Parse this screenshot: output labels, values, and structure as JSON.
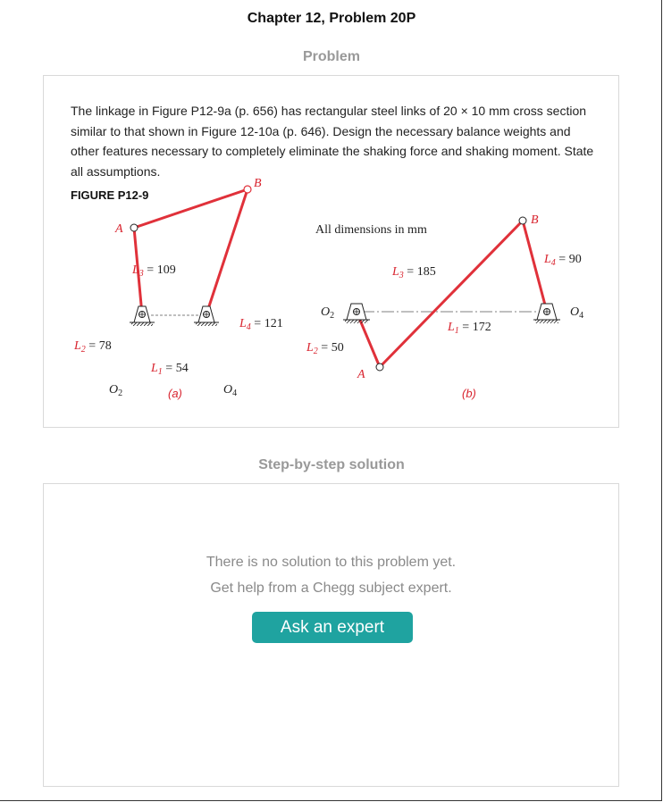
{
  "page": {
    "chapter_title": "Chapter 12, Problem 20P"
  },
  "problem": {
    "heading": "Problem",
    "text": "The linkage in Figure P12-9a (p. 656) has rectangular steel links of 20 × 10 mm cross section similar to that shown in Figure 12-10a (p. 646). Design the necessary balance weights and other features necessary to completely eliminate the shaking force and shaking moment. State all assumptions.",
    "figure_label": "FIGURE P12-9"
  },
  "figure": {
    "dims_note": "All dimensions in mm",
    "colors": {
      "link": "#e0313a",
      "label": "#d8232e",
      "black": "#222222"
    },
    "a": {
      "caption": "(a)",
      "L1": "L1 = 54",
      "L2": "L2 = 78",
      "L3": "L3 = 109",
      "L4": "L4 = 121",
      "pA": "A",
      "pB": "B",
      "O2": "O2",
      "O4": "O4"
    },
    "b": {
      "caption": "(b)",
      "L1": "L1 = 172",
      "L2": "L2 = 50",
      "L3": "L3 = 185",
      "L4": "L4 = 90",
      "pA": "A",
      "pB": "B",
      "O2": "O2",
      "O4": "O4"
    }
  },
  "solution": {
    "heading": "Step-by-step solution",
    "line1": "There is no solution to this problem yet.",
    "line2": "Get help from a Chegg subject expert.",
    "button_label": "Ask an expert",
    "button_color": "#1fa3a0"
  }
}
